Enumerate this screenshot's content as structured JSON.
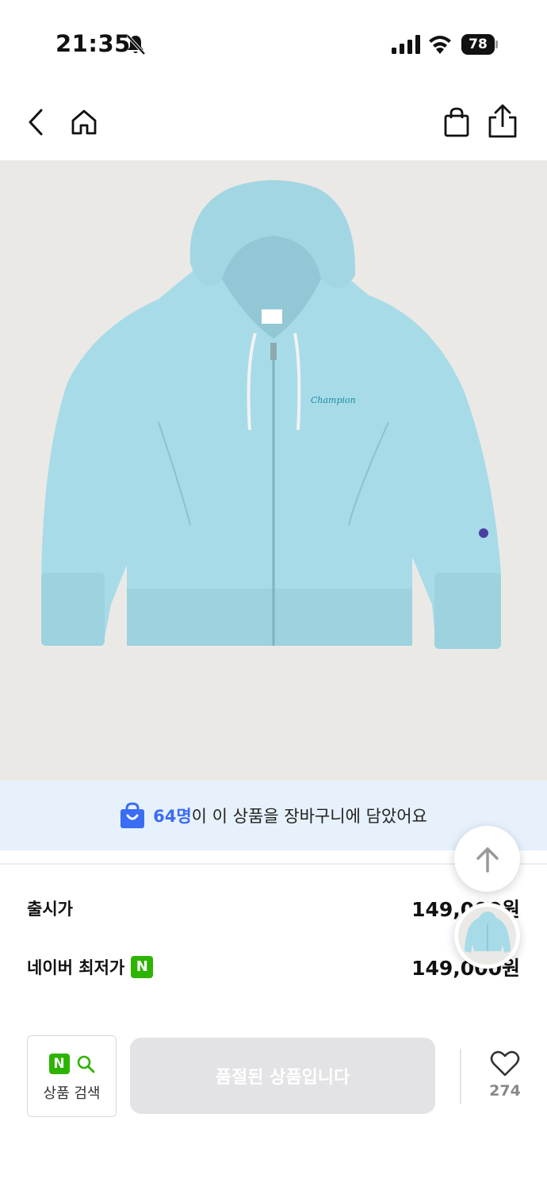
{
  "status_bar": {
    "time": "21:35",
    "battery": "78"
  },
  "nav": {
    "back_icon": "chevron-left-icon",
    "home_icon": "home-icon",
    "bag_icon": "shopping-bag-icon",
    "share_icon": "share-icon"
  },
  "product": {
    "image_alt": "hoodie-image",
    "brand_script": "Champion"
  },
  "cart_banner": {
    "count": "64명",
    "text": "이 이 상품을 장바구니에 담았어요",
    "accent_color": "#3a6cf4"
  },
  "prices": {
    "release_label": "출시가",
    "release_value": "149,000원",
    "naver_label": "네이버 최저가",
    "naver_badge": "N",
    "naver_value": "149,000원"
  },
  "bottom_bar": {
    "naver_search_badge": "N",
    "naver_search_label": "상품 검색",
    "soldout_label": "품절된 상품입니다",
    "like_count": "274"
  },
  "colors": {
    "naver_green": "#2db400",
    "banner_bg": "#e7f1fb",
    "hoodie": "#a8dbe8"
  }
}
